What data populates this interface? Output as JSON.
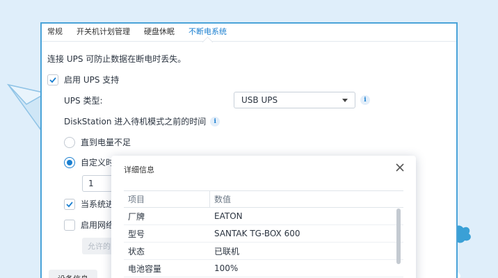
{
  "tabs": [
    "常规",
    "开关机计划管理",
    "硬盘休眠",
    "不断电系统"
  ],
  "active_tab": 3,
  "description": "连接 UPS 可防止数据在断电时丢失。",
  "enable_ups": {
    "label": "启用 UPS 支持",
    "checked": true
  },
  "ups_type": {
    "label": "UPS 类型:",
    "value": "USB UPS"
  },
  "standby_label": "DiskStation 进入待机模式之前的时间",
  "options": {
    "until_low": "直到电量不足",
    "custom": "自定义时",
    "custom_value": "1"
  },
  "shutdown_check": {
    "label": "当系统进",
    "checked": true
  },
  "network_check": {
    "label": "启用网络",
    "checked": false
  },
  "allow_button": "允许的",
  "device_info_button": "设备信息",
  "dialog": {
    "title": "详细信息",
    "columns": [
      "项目",
      "数值"
    ],
    "rows": [
      {
        "item": "厂牌",
        "value": "EATON"
      },
      {
        "item": "型号",
        "value": "SANTAK TG-BOX 600"
      },
      {
        "item": "状态",
        "value": "已联机"
      },
      {
        "item": "电池容量",
        "value": "100%"
      }
    ]
  },
  "colors": {
    "accent": "#1a7fd0",
    "frame": "#4aa3d8",
    "background": "#dfeefa"
  },
  "icons": [
    "paper-plane-icon",
    "cloud-icon",
    "check-icon",
    "info-icon",
    "chevron-down-icon",
    "close-icon"
  ]
}
